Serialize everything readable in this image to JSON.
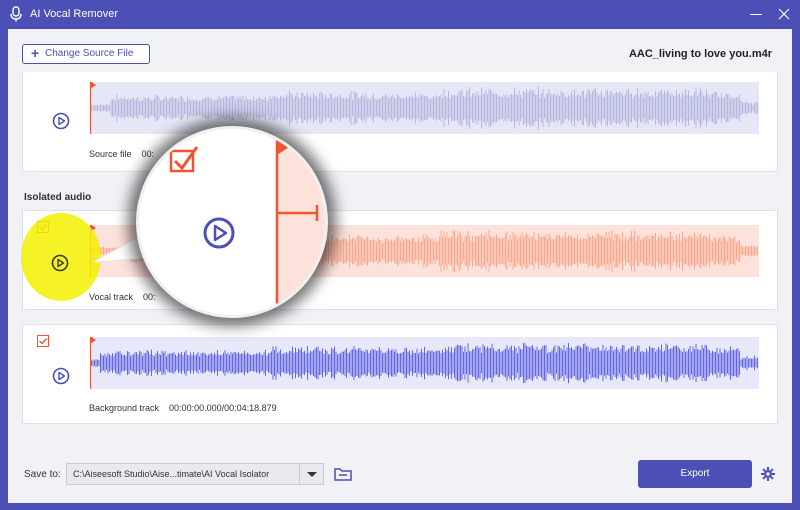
{
  "app": {
    "title": "AI Vocal Remover"
  },
  "toolbar": {
    "change_source_label": "Change Source File",
    "file_name": "AAC_living to love you.m4r"
  },
  "source": {
    "label": "Source file",
    "time": "00:"
  },
  "isolated": {
    "heading": "Isolated audio",
    "vocal": {
      "label": "Vocal track",
      "time": "00:",
      "checked": true
    },
    "background": {
      "label": "Background track",
      "time": "00:00:00.000/00:04:18.879",
      "checked": true
    }
  },
  "footer": {
    "save_label": "Save to:",
    "save_path": "C:\\Aiseesoft Studio\\Aise...timate\\AI Vocal Isolator",
    "export_label": "Export"
  },
  "colors": {
    "brand": "#4b4fb6",
    "source_wave": "#b6b8e0",
    "vocal_wave": "#f8a98f",
    "background_wave": "#6367e6",
    "playhead": "#ee5533",
    "highlight": "#f3f000"
  },
  "icons": {
    "app": "mic-icon",
    "minimize": "minimize-icon",
    "close": "close-icon",
    "add": "plus-icon",
    "play": "play-circle-icon",
    "checkbox": "checkbox-icon",
    "folder": "folder-icon",
    "settings": "gear-icon",
    "magnifier": "magnifier-lens"
  }
}
